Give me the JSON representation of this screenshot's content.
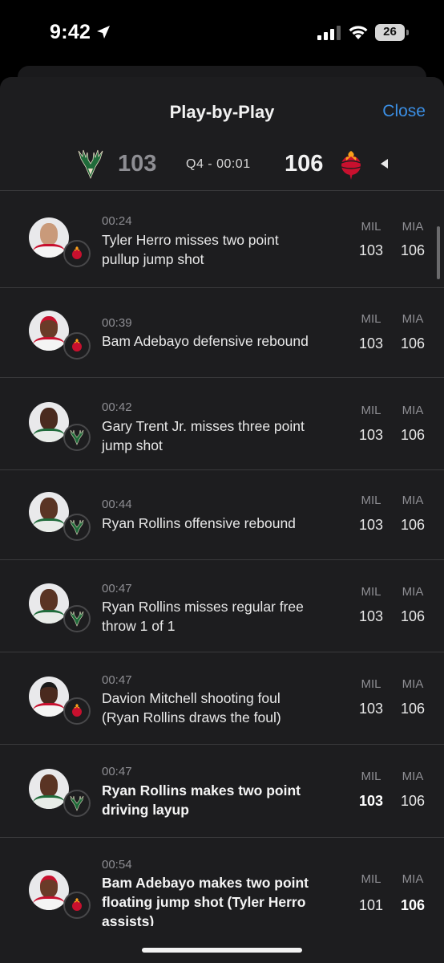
{
  "status_bar": {
    "time": "9:42",
    "battery": "26"
  },
  "sheet": {
    "title": "Play-by-Play",
    "close_label": "Close"
  },
  "scoreboard": {
    "home_score": "103",
    "away_score": "106",
    "clock": "Q4 - 00:01"
  },
  "columns": {
    "home": "MIL",
    "away": "MIA"
  },
  "colors": {
    "accent": "#3b8fe5",
    "heat_red": "#c8102e",
    "bucks_green": "#1f6b3a"
  },
  "plays": [
    {
      "time": "00:24",
      "line1": "Tyler Herro misses two point",
      "line2": "pullup jump shot",
      "home": "103",
      "away": "106",
      "team": "heat-logo-icon",
      "bold": false
    },
    {
      "time": "00:39",
      "line1": "Bam Adebayo defensive rebound",
      "line2": "",
      "home": "103",
      "away": "106",
      "team": "heat-logo-icon",
      "bold": false
    },
    {
      "time": "00:42",
      "line1": "Gary Trent Jr. misses three point",
      "line2": "jump shot",
      "home": "103",
      "away": "106",
      "team": "bucks-logo-icon",
      "bold": false
    },
    {
      "time": "00:44",
      "line1": "Ryan Rollins offensive rebound",
      "line2": "",
      "home": "103",
      "away": "106",
      "team": "bucks-logo-icon",
      "bold": false
    },
    {
      "time": "00:47",
      "line1": "Ryan Rollins misses regular free",
      "line2": "throw 1 of 1",
      "home": "103",
      "away": "106",
      "team": "bucks-logo-icon",
      "bold": false
    },
    {
      "time": "00:47",
      "line1": "Davion Mitchell shooting foul",
      "line2": "(Ryan Rollins draws the foul)",
      "home": "103",
      "away": "106",
      "team": "heat-logo-icon",
      "bold": false
    },
    {
      "time": "00:47",
      "line1": "Ryan Rollins makes two point",
      "line2": "driving layup",
      "home": "103",
      "away": "106",
      "team": "bucks-logo-icon",
      "bold": true
    },
    {
      "time": "00:54",
      "line1": "Bam Adebayo makes two point",
      "line2": "floating jump shot (Tyler Herro",
      "line3": "assists)",
      "home": "101",
      "away": "106",
      "team": "heat-logo-icon",
      "bold": true
    }
  ]
}
